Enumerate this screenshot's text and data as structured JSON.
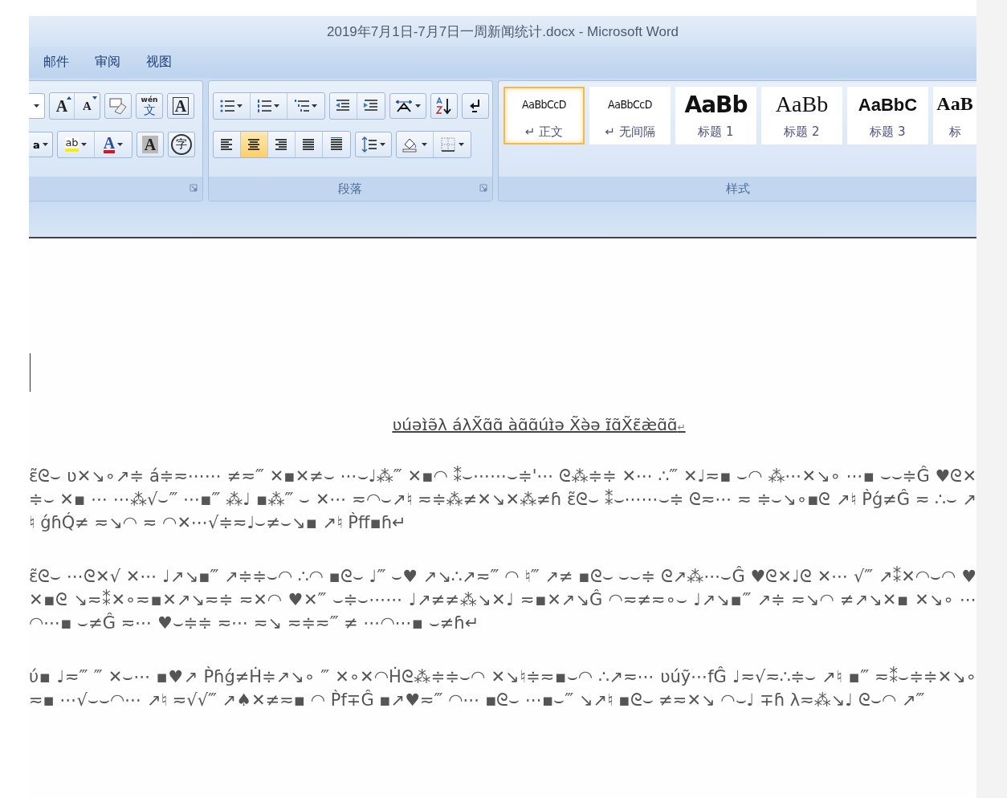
{
  "window": {
    "title": "2019年7月1日-7月7日一周新闻统计.docx - Microsoft Word"
  },
  "tabs": [
    {
      "label": "邮件",
      "selected": false
    },
    {
      "label": "审阅",
      "selected": false
    },
    {
      "label": "视图",
      "selected": false
    }
  ],
  "font_group": {
    "grow_glyph": "A",
    "shrink_glyph": "A",
    "phonetic_ruby": "wén",
    "phonetic_glyph": "文",
    "border_glyph": "A",
    "case_glyph": "a",
    "highlight_glyph": "ab",
    "color_glyph": "A",
    "shading_glyph": "A",
    "enclose_glyph": "字"
  },
  "paragraph_group": {
    "label": "段落",
    "alignment": [
      {
        "kind": "left",
        "selected": false
      },
      {
        "kind": "center",
        "selected": true
      },
      {
        "kind": "right",
        "selected": false
      },
      {
        "kind": "justify",
        "selected": false
      },
      {
        "kind": "distributed",
        "selected": false
      }
    ]
  },
  "styles_group": {
    "label": "样式",
    "styles": [
      {
        "kind": "body",
        "preview": "AaBbCcD",
        "label": "↵ 正文",
        "selected": true
      },
      {
        "kind": "nospacing",
        "preview": "AaBbCcD",
        "label": "↵ 无间隔",
        "selected": false
      },
      {
        "kind": "h1",
        "preview": "AaBb",
        "label": "标题 1",
        "selected": false
      },
      {
        "kind": "h2",
        "preview": "AaBb",
        "label": "标题 2",
        "selected": false
      },
      {
        "kind": "h3",
        "preview": "AaBbC",
        "label": "标题 3",
        "selected": false
      },
      {
        "kind": "h4",
        "preview": "AaB",
        "label": "标",
        "selected": false
      }
    ]
  },
  "document": {
    "title": "ʋúəɪ̀ə̃λ áλX̃ɑ̃ɑ̃ àɑ̃ɑ̃úɪ̀ə X̃ə̀ə ɪ̃ɑ̃X̃ɛ̃æ̀ɑ̃ɑ̃",
    "title_mark": "↵",
    "paragraphs": [
      "ɛ̃ᘓ⌣ ʋ✕↘∘↗≑ á≑≂⋯⋯ ≠≂‴ ✕▪✕≠⌣ ⋯⌣♩⁂‴ ✕▪◠ ⁑⌣⋯⋯⌣≑'⋯ ᘓ⁂≑≑ ✕⋯ ∴‴ ✕♩≂▪ ⌣◠ ⁂⋯✕↘∘ ⋯▪ ⌣⌣≑Ĝ ♥ᘓ✕≑⌣ ✕▪ ⋯ ⋯⁂√⌣‴ ⋯▪‴ ⁂♩ ▪⁂‴ ⌣ ✕⋯ ≂◠⌣↗♮ ≂≑⁂≠✕↘✕⁂≠ɦ ɛ̃ᘓ⌣ ⁑⌣⋯⋯⌣≑ ᘓ≂⋯ ≂ ≑⌣↘∘▪ᘓ ↗♮ P̀ǵ≠Ĝ ≂ ∴⌣ ↗♮ ǵɦQ́≠ ≂↘◠ ≂ ◠✕⋯√≑≂♩⌣≠⌣↘▪ ↗♮ P̀ff▪ɦ↵",
      "ɛ̃ᘓ⌣ ⋯ᘓ✕√ ✕⋯ ♩↗↘▪‴ ↗≑≑⌣◠ ∴◠ ▪ᘓ⌣ ♩‴ ⌣♥ ↗↘∴↗≂‴ ◠ ♮‴ ↗≠ ▪ᘓ⌣ ⌣⌣≑ ᘓ↗⁂⋯⌣Ĝ ♥ᘓ✕♩ᘓ ✕⋯ √‴ ↗⁑✕◠⌣◠ ♥✕▪ᘓ ↘≂⁑✕∘≂▪✕↗↘≂≑ ≂✕◠ ♥✕‴ ⌣≑⌣⋯⋯ ♩↗≠≠⁂↘✕♩ ≂▪✕↗↘Ĝ ◠≂≠≂∘⌣ ♩↗↘▪‴ ↗≑ ≂↘◠ ≠↗↘✕▪ ✕↘∘ ⋯◠⋯▪ ⌣≠Ĝ ≂⋯ ♥⌣≑≑ ≂⋯ ≂↘ ≂≑≂‴ ≠ ⋯◠⋯▪ ⌣≠ɦ↵",
      "ύ▪ ♩≂‴ ‴ ✕⌣⋯ ▪♥↗ P̀ɦǵ≠Ḣ≑↗↘∘ ‴ ✕∘✕◠Ḣᘓ⁂≑≑⌣◠ ✕↘♮≑≂▪⌣◠ ∴↗≂⋯ ʋúỹ⋯fĜ ♩≂√≂∴≑⌣ ↗♮ ▪‴ ≂⁑⌣≑≑✕↘∘ ≂▪ ⋯√⌣⌣◠⋯ ↗♮ ≂√√‴ ↗♠✕≠≂▪ ◠ P̀f∓Ĝ ▪↗♥≂‴ ◠⋯ ▪ᘓ⌣ ⋯▪⌣‴ ↘↗♮ ▪ᘓ⌣ ≠≂✕↘ ◠⌣♩ ∓ɦ λ≂⁂↘♩ ᘓ⌣◠ ↗‴"
    ]
  }
}
